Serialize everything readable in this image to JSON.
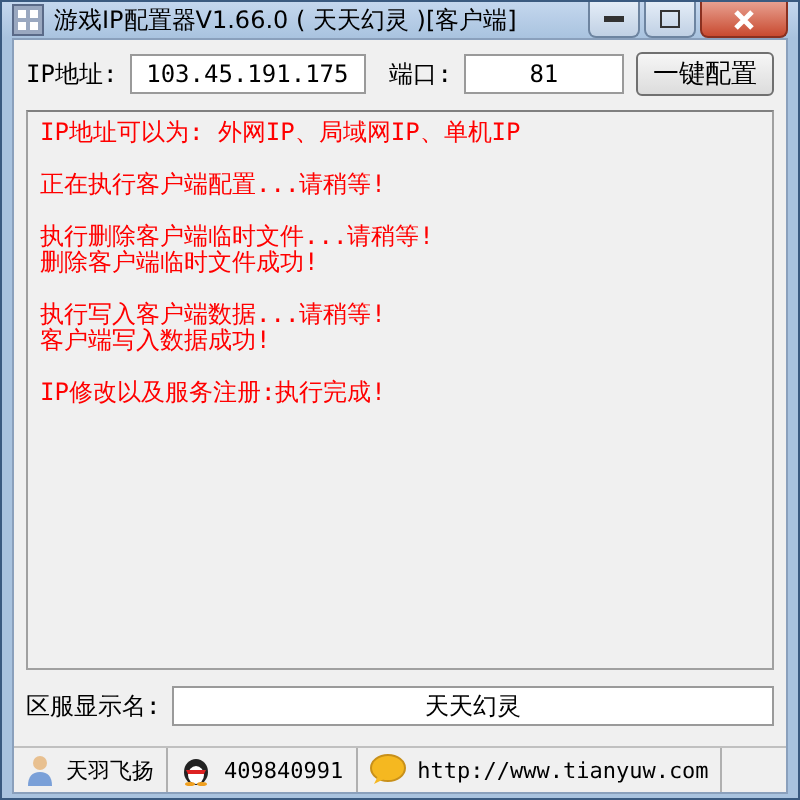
{
  "window": {
    "title": "游戏IP配置器V1.66.0 ( 天天幻灵 )[客户端]"
  },
  "ip": {
    "label": "IP地址:",
    "value": "103.45.191.175"
  },
  "port": {
    "label": "端口:",
    "value": "81"
  },
  "config_button": "一键配置",
  "log": [
    [
      "IP地址可以为:  外网IP、局域网IP、单机IP"
    ],
    [
      "正在执行客户端配置...请稍等!"
    ],
    [
      "执行删除客户端临时文件...请稍等!",
      "删除客户端临时文件成功!"
    ],
    [
      "执行写入客户端数据...请稍等!",
      "客户端写入数据成功!"
    ],
    [
      "IP修改以及服务注册:执行完成!"
    ]
  ],
  "server_name": {
    "label": "区服显示名:",
    "value": "天天幻灵"
  },
  "status_bar": [
    {
      "kind": "person",
      "text": "天羽飞扬"
    },
    {
      "kind": "penguin",
      "text": "409840991"
    },
    {
      "kind": "chat",
      "text": "http://www.tianyuw.com"
    }
  ]
}
